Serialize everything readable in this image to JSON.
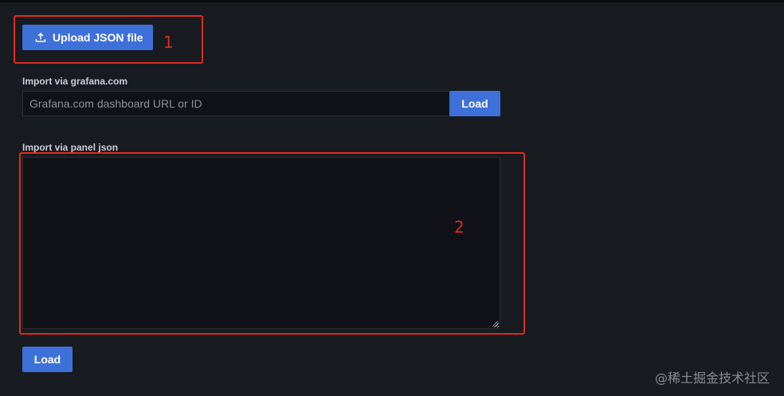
{
  "upload": {
    "label": "Upload JSON file",
    "icon": "upload-icon"
  },
  "grafana_import": {
    "label": "Import via grafana.com",
    "placeholder": "Grafana.com dashboard URL or ID",
    "value": "",
    "load_label": "Load"
  },
  "panel_json": {
    "label": "Import via panel json",
    "value": "",
    "load_label": "Load"
  },
  "annotations": {
    "one": "1",
    "two": "2",
    "color": "#e02a1f"
  },
  "watermark": "@稀土掘金技术社区",
  "colors": {
    "primary": "#3d71d9",
    "background": "#181b1f",
    "input_bg": "#111217"
  }
}
